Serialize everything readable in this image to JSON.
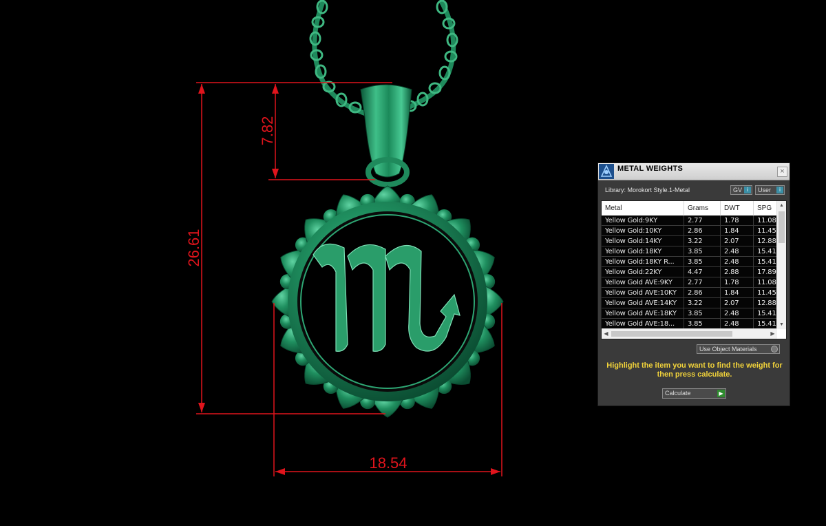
{
  "dimensions": {
    "bail_height": "7.82",
    "total_height": "26.61",
    "width": "18.54"
  },
  "panel": {
    "title": "METAL WEIGHTS",
    "close_symbol": "×",
    "library_label": "Library: Morokort Style.1-Metal",
    "gv_label": "GV",
    "user_label": "User",
    "columns": [
      "Metal",
      "Grams",
      "DWT",
      "SPG"
    ],
    "rows": [
      [
        "Yellow Gold:9KY",
        "2.77",
        "1.78",
        "11.08"
      ],
      [
        "Yellow Gold:10KY",
        "2.86",
        "1.84",
        "11.45"
      ],
      [
        "Yellow Gold:14KY",
        "3.22",
        "2.07",
        "12.88"
      ],
      [
        "Yellow Gold:18KY",
        "3.85",
        "2.48",
        "15.41"
      ],
      [
        "Yellow Gold:18KY R...",
        "3.85",
        "2.48",
        "15.41"
      ],
      [
        "Yellow Gold:22KY",
        "4.47",
        "2.88",
        "17.89"
      ],
      [
        "Yellow Gold AVE:9KY",
        "2.77",
        "1.78",
        "11.08"
      ],
      [
        "Yellow Gold AVE:10KY",
        "2.86",
        "1.84",
        "11.45"
      ],
      [
        "Yellow Gold AVE:14KY",
        "3.22",
        "2.07",
        "12.88"
      ],
      [
        "Yellow Gold AVE:18KY",
        "3.85",
        "2.48",
        "15.41"
      ],
      [
        "Yellow Gold AVE:18...",
        "3.85",
        "2.48",
        "15.41"
      ]
    ],
    "use_object_materials": "Use Object Materials",
    "instructions": "Highlight the item you want to find the weight for then press calculate.",
    "calculate_label": "Calculate"
  },
  "colors": {
    "dimension_red": "#e0141c",
    "model_green": "#1f8a5c",
    "instruction_yellow": "#f2d33a"
  }
}
